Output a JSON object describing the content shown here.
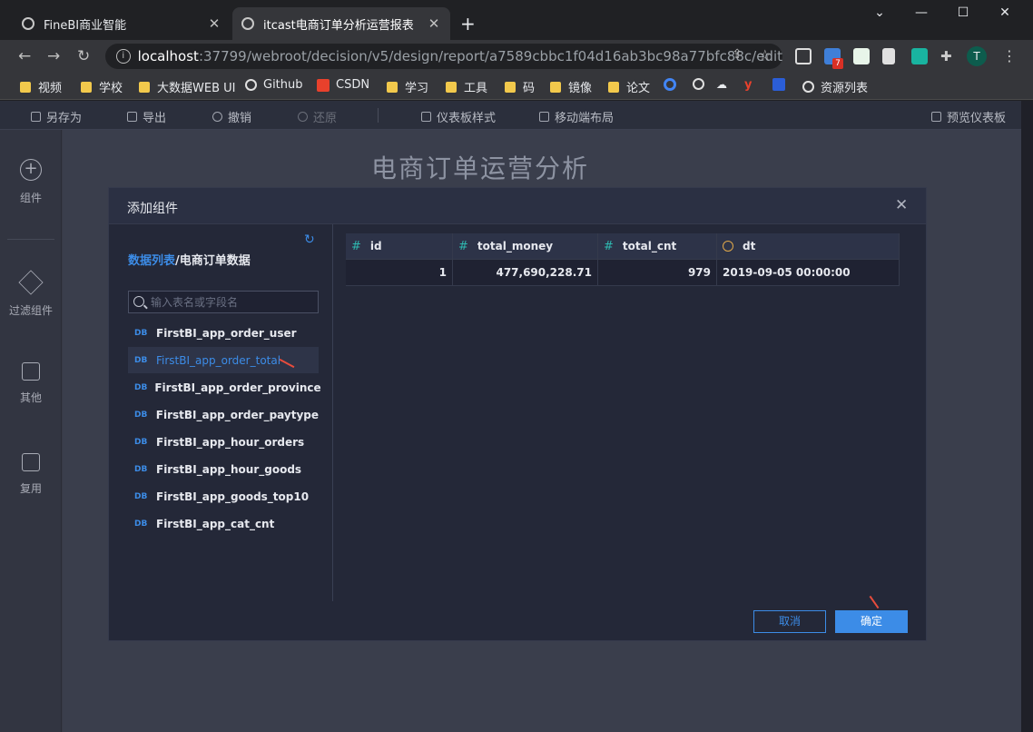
{
  "browser": {
    "tabs": [
      {
        "title": "FineBI商业智能"
      },
      {
        "title": "itcast电商订单分析运营报表"
      }
    ],
    "url_host": "localhost",
    "url_path": ":37799/webroot/decision/v5/design/report/a7589cbbc1f04d16ab3bc98a77bfc88c/edit",
    "extension_badge": "7",
    "profile_initial": "T",
    "bookmarks": [
      "视频",
      "学校",
      "大数据WEB UI",
      "Github",
      "CSDN",
      "学习",
      "工具",
      "码",
      "镜像",
      "论文",
      "资源列表"
    ]
  },
  "toolbar": {
    "save_as": "另存为",
    "export": "导出",
    "undo": "撤销",
    "redo": "还原",
    "dashboard_style": "仪表板样式",
    "mobile_layout": "移动端布局",
    "preview": "预览仪表板"
  },
  "left_panel": {
    "components": "组件",
    "filter": "过滤组件",
    "other": "其他",
    "reuse": "复用"
  },
  "report_title": "电商订单运营分析",
  "modal": {
    "title": "添加组件",
    "breadcrumb_link": "数据列表",
    "breadcrumb_sep": "/",
    "breadcrumb_current": "电商订单数据",
    "search_placeholder": "输入表名或字段名",
    "db_label": "DB",
    "tables": [
      "FirstBI_app_order_user",
      "FirstBI_app_order_total",
      "FirstBI_app_order_province",
      "FirstBI_app_order_paytype",
      "FirstBI_app_hour_orders",
      "FirstBI_app_hour_goods",
      "FirstBI_app_goods_top10",
      "FirstBI_app_cat_cnt"
    ],
    "selected_table_index": 1,
    "columns": [
      "id",
      "total_money",
      "total_cnt",
      "dt"
    ],
    "rows": [
      [
        "1",
        "477,690,228.71",
        "979",
        "2019-09-05 00:00:00"
      ]
    ],
    "cancel": "取消",
    "ok": "确定"
  }
}
